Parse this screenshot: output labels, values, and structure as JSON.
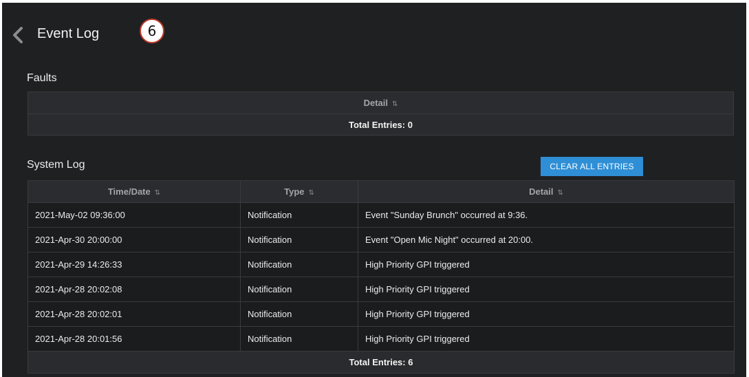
{
  "header": {
    "title": "Event Log",
    "step_badge": "6"
  },
  "faults": {
    "title": "Faults",
    "columns": [
      {
        "label": "Detail",
        "sort_icon": "⇅"
      }
    ],
    "total_label": "Total Entries: 0"
  },
  "system_log": {
    "title": "System Log",
    "clear_label": "CLEAR ALL ENTRIES",
    "columns": [
      {
        "label": "Time/Date",
        "sort_icon": "⇅"
      },
      {
        "label": "Type",
        "sort_icon": "⇅"
      },
      {
        "label": "Detail",
        "sort_icon": "⇅"
      }
    ],
    "rows": [
      {
        "time": "2021-May-02 09:36:00",
        "type": "Notification",
        "detail": "Event \"Sunday Brunch\" occurred at 9:36."
      },
      {
        "time": "2021-Apr-30 20:00:00",
        "type": "Notification",
        "detail": "Event \"Open Mic Night\" occurred at 20:00."
      },
      {
        "time": "2021-Apr-29 14:26:33",
        "type": "Notification",
        "detail": "High Priority GPI triggered"
      },
      {
        "time": "2021-Apr-28 20:02:08",
        "type": "Notification",
        "detail": "High Priority GPI triggered"
      },
      {
        "time": "2021-Apr-28 20:02:01",
        "type": "Notification",
        "detail": "High Priority GPI triggered"
      },
      {
        "time": "2021-Apr-28 20:01:56",
        "type": "Notification",
        "detail": "High Priority GPI triggered"
      }
    ],
    "total_label": "Total Entries: 6"
  },
  "icons": {
    "back": "chevron-left-icon",
    "sort": "sort-arrows-icon"
  },
  "colors": {
    "background": "#1f2022",
    "accent": "#2f8fd6",
    "badge_border": "#c0392b"
  }
}
